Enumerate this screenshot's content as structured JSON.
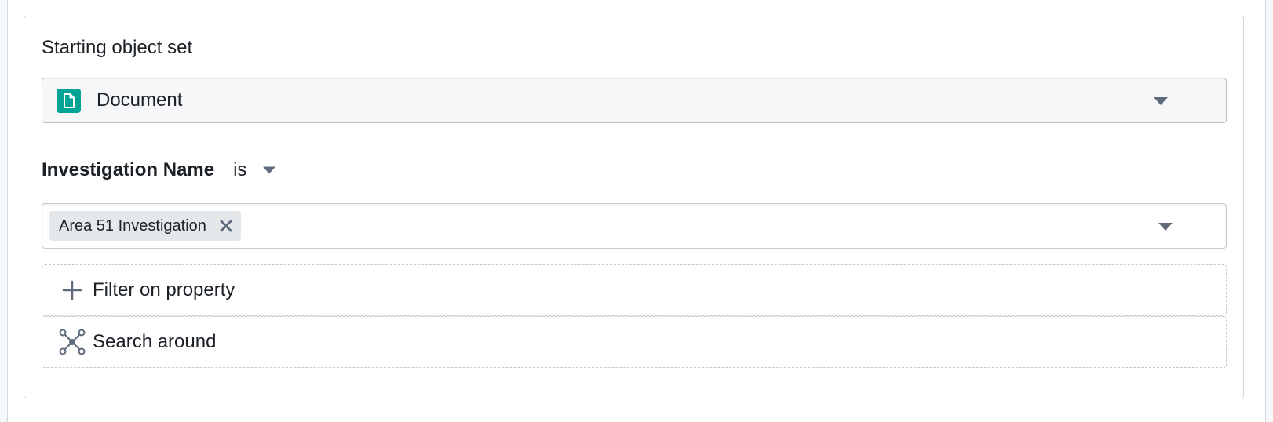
{
  "starting_object_set": {
    "title": "Starting object set",
    "selected_object_type": "Document",
    "object_icon": "document-icon",
    "object_icon_color": "#00a396"
  },
  "filter": {
    "property_name": "Investigation Name",
    "operator": "is",
    "values": [
      {
        "label": "Area 51 Investigation"
      }
    ]
  },
  "actions": {
    "filter_on_property": {
      "label": "Filter on property",
      "icon": "plus-icon"
    },
    "search_around": {
      "label": "Search around",
      "icon": "graph-nodes-icon"
    }
  },
  "colors": {
    "text": "#1c2127",
    "icon_gray": "#5f6b7c",
    "tag_background": "#e5e8eb",
    "border": "#d3d8de"
  }
}
